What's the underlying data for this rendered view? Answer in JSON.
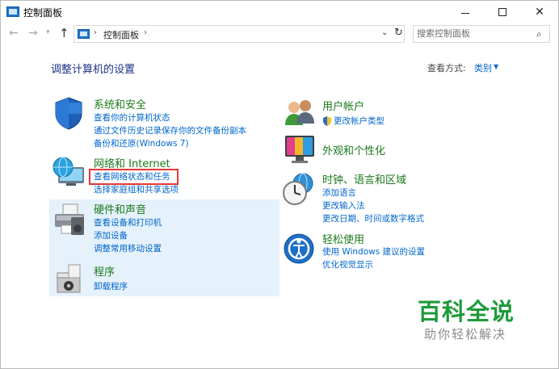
{
  "window": {
    "title": "控制面板"
  },
  "address": {
    "crumb": "控制面板",
    "search_placeholder": "搜索控制面板"
  },
  "header": {
    "page_title": "调整计算机的设置",
    "view_by_label": "查看方式:",
    "view_by_value": "类别"
  },
  "categories": [
    {
      "title": "系统和安全",
      "icon": "shield-icon",
      "links": [
        "查看你的计算机状态",
        "通过文件历史记录保存你的文件备份副本",
        "备份和还原(Windows 7)"
      ]
    },
    {
      "title": "网络和 Internet",
      "icon": "network-globe-icon",
      "links": [
        "查看网络状态和任务",
        "选择家庭组和共享选项"
      ]
    },
    {
      "title": "硬件和声音",
      "icon": "printer-icon",
      "links": [
        "查看设备和打印机",
        "添加设备",
        "调整常用移动设置"
      ]
    },
    {
      "title": "程序",
      "icon": "programs-box-icon",
      "links": [
        "卸载程序"
      ]
    },
    {
      "title": "用户帐户",
      "icon": "users-icon",
      "links": [
        "更改帐户类型"
      ]
    },
    {
      "title": "外观和个性化",
      "icon": "monitor-icon",
      "links": []
    },
    {
      "title": "时钟、语言和区域",
      "icon": "clock-globe-icon",
      "links": [
        "添加语言",
        "更改输入法",
        "更改日期、时间或数字格式"
      ]
    },
    {
      "title": "轻松使用",
      "icon": "ease-of-access-icon",
      "links": [
        "使用 Windows 建议的设置",
        "优化视觉显示"
      ]
    }
  ],
  "watermark": {
    "title": "百科全说",
    "subtitle": "助你轻松解决"
  },
  "colors": {
    "link": "#0066cc",
    "category_title": "#1a7a1a",
    "highlight": "#e5f1fb",
    "annotation": "#e53935",
    "watermark": "#1e9a3a"
  }
}
